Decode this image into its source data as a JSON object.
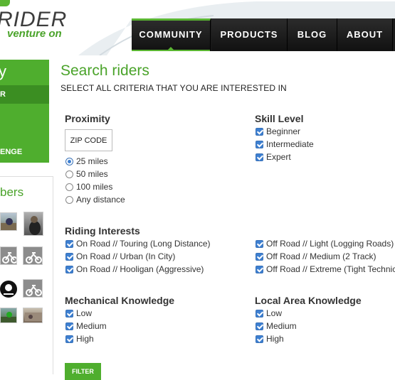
{
  "brand": {
    "logo": "RIDER",
    "tagline": "venture on",
    "accent": "#4fae2e",
    "nav_bg": "#1b1b1b"
  },
  "nav": {
    "items": [
      {
        "label": "COMMUNITY",
        "active": true
      },
      {
        "label": "PRODUCTS",
        "active": false
      },
      {
        "label": "BLOG",
        "active": false
      },
      {
        "label": "ABOUT",
        "active": false
      }
    ]
  },
  "sidebar": {
    "heading": "y",
    "items": [
      {
        "label": "R"
      },
      {
        "label": "ENGE"
      }
    ],
    "members_heading": "bers",
    "member_icons": [
      "rider-photo",
      "rider-photo",
      "motorcycle-icon",
      "motorcycle-icon",
      "pirate-badge-icon",
      "motorcycle-icon",
      "rider-photo",
      "rider-photo"
    ]
  },
  "main": {
    "title": "Search riders",
    "subtitle": "SELECT ALL CRITERIA THAT YOU ARE INTERESTED IN",
    "proximity": {
      "title": "Proximity",
      "zip_button": "ZIP CODE",
      "options": [
        {
          "label": "25 miles",
          "selected": true
        },
        {
          "label": "50 miles",
          "selected": false
        },
        {
          "label": "100 miles",
          "selected": false
        },
        {
          "label": "Any distance",
          "selected": false
        }
      ]
    },
    "skill": {
      "title": "Skill Level",
      "options": [
        {
          "label": "Beginner",
          "checked": true
        },
        {
          "label": "Intermediate",
          "checked": true
        },
        {
          "label": "Expert",
          "checked": true
        }
      ]
    },
    "riding": {
      "title": "Riding Interests",
      "left": [
        {
          "label": "On Road // Touring (Long Distance)",
          "checked": true
        },
        {
          "label": "On Road // Urban (In City)",
          "checked": true
        },
        {
          "label": "On Road // Hooligan (Aggressive)",
          "checked": true
        }
      ],
      "right": [
        {
          "label": "Off Road // Light (Logging Roads)",
          "checked": true
        },
        {
          "label": "Off Road // Medium (2 Track)",
          "checked": true
        },
        {
          "label": "Off Road // Extreme (Tight Technic",
          "checked": true
        }
      ]
    },
    "mechanical": {
      "title": "Mechanical Knowledge",
      "options": [
        {
          "label": "Low",
          "checked": true
        },
        {
          "label": "Medium",
          "checked": true
        },
        {
          "label": "High",
          "checked": true
        }
      ]
    },
    "local": {
      "title": "Local Area Knowledge",
      "options": [
        {
          "label": "Low",
          "checked": true
        },
        {
          "label": "Medium",
          "checked": true
        },
        {
          "label": "High",
          "checked": true
        }
      ]
    },
    "filter_button": "FILTER"
  }
}
